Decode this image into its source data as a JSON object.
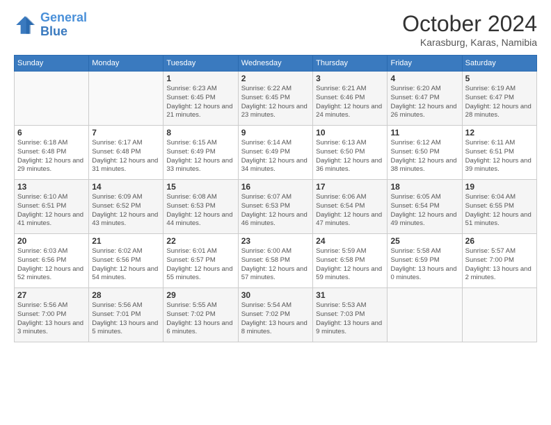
{
  "header": {
    "logo_line1": "General",
    "logo_line2": "Blue",
    "month_title": "October 2024",
    "location": "Karasburg, Karas, Namibia"
  },
  "weekdays": [
    "Sunday",
    "Monday",
    "Tuesday",
    "Wednesday",
    "Thursday",
    "Friday",
    "Saturday"
  ],
  "weeks": [
    [
      {
        "day": "",
        "info": ""
      },
      {
        "day": "",
        "info": ""
      },
      {
        "day": "1",
        "info": "Sunrise: 6:23 AM\nSunset: 6:45 PM\nDaylight: 12 hours and 21 minutes."
      },
      {
        "day": "2",
        "info": "Sunrise: 6:22 AM\nSunset: 6:45 PM\nDaylight: 12 hours and 23 minutes."
      },
      {
        "day": "3",
        "info": "Sunrise: 6:21 AM\nSunset: 6:46 PM\nDaylight: 12 hours and 24 minutes."
      },
      {
        "day": "4",
        "info": "Sunrise: 6:20 AM\nSunset: 6:47 PM\nDaylight: 12 hours and 26 minutes."
      },
      {
        "day": "5",
        "info": "Sunrise: 6:19 AM\nSunset: 6:47 PM\nDaylight: 12 hours and 28 minutes."
      }
    ],
    [
      {
        "day": "6",
        "info": "Sunrise: 6:18 AM\nSunset: 6:48 PM\nDaylight: 12 hours and 29 minutes."
      },
      {
        "day": "7",
        "info": "Sunrise: 6:17 AM\nSunset: 6:48 PM\nDaylight: 12 hours and 31 minutes."
      },
      {
        "day": "8",
        "info": "Sunrise: 6:15 AM\nSunset: 6:49 PM\nDaylight: 12 hours and 33 minutes."
      },
      {
        "day": "9",
        "info": "Sunrise: 6:14 AM\nSunset: 6:49 PM\nDaylight: 12 hours and 34 minutes."
      },
      {
        "day": "10",
        "info": "Sunrise: 6:13 AM\nSunset: 6:50 PM\nDaylight: 12 hours and 36 minutes."
      },
      {
        "day": "11",
        "info": "Sunrise: 6:12 AM\nSunset: 6:50 PM\nDaylight: 12 hours and 38 minutes."
      },
      {
        "day": "12",
        "info": "Sunrise: 6:11 AM\nSunset: 6:51 PM\nDaylight: 12 hours and 39 minutes."
      }
    ],
    [
      {
        "day": "13",
        "info": "Sunrise: 6:10 AM\nSunset: 6:51 PM\nDaylight: 12 hours and 41 minutes."
      },
      {
        "day": "14",
        "info": "Sunrise: 6:09 AM\nSunset: 6:52 PM\nDaylight: 12 hours and 43 minutes."
      },
      {
        "day": "15",
        "info": "Sunrise: 6:08 AM\nSunset: 6:53 PM\nDaylight: 12 hours and 44 minutes."
      },
      {
        "day": "16",
        "info": "Sunrise: 6:07 AM\nSunset: 6:53 PM\nDaylight: 12 hours and 46 minutes."
      },
      {
        "day": "17",
        "info": "Sunrise: 6:06 AM\nSunset: 6:54 PM\nDaylight: 12 hours and 47 minutes."
      },
      {
        "day": "18",
        "info": "Sunrise: 6:05 AM\nSunset: 6:54 PM\nDaylight: 12 hours and 49 minutes."
      },
      {
        "day": "19",
        "info": "Sunrise: 6:04 AM\nSunset: 6:55 PM\nDaylight: 12 hours and 51 minutes."
      }
    ],
    [
      {
        "day": "20",
        "info": "Sunrise: 6:03 AM\nSunset: 6:56 PM\nDaylight: 12 hours and 52 minutes."
      },
      {
        "day": "21",
        "info": "Sunrise: 6:02 AM\nSunset: 6:56 PM\nDaylight: 12 hours and 54 minutes."
      },
      {
        "day": "22",
        "info": "Sunrise: 6:01 AM\nSunset: 6:57 PM\nDaylight: 12 hours and 55 minutes."
      },
      {
        "day": "23",
        "info": "Sunrise: 6:00 AM\nSunset: 6:58 PM\nDaylight: 12 hours and 57 minutes."
      },
      {
        "day": "24",
        "info": "Sunrise: 5:59 AM\nSunset: 6:58 PM\nDaylight: 12 hours and 59 minutes."
      },
      {
        "day": "25",
        "info": "Sunrise: 5:58 AM\nSunset: 6:59 PM\nDaylight: 13 hours and 0 minutes."
      },
      {
        "day": "26",
        "info": "Sunrise: 5:57 AM\nSunset: 7:00 PM\nDaylight: 13 hours and 2 minutes."
      }
    ],
    [
      {
        "day": "27",
        "info": "Sunrise: 5:56 AM\nSunset: 7:00 PM\nDaylight: 13 hours and 3 minutes."
      },
      {
        "day": "28",
        "info": "Sunrise: 5:56 AM\nSunset: 7:01 PM\nDaylight: 13 hours and 5 minutes."
      },
      {
        "day": "29",
        "info": "Sunrise: 5:55 AM\nSunset: 7:02 PM\nDaylight: 13 hours and 6 minutes."
      },
      {
        "day": "30",
        "info": "Sunrise: 5:54 AM\nSunset: 7:02 PM\nDaylight: 13 hours and 8 minutes."
      },
      {
        "day": "31",
        "info": "Sunrise: 5:53 AM\nSunset: 7:03 PM\nDaylight: 13 hours and 9 minutes."
      },
      {
        "day": "",
        "info": ""
      },
      {
        "day": "",
        "info": ""
      }
    ]
  ]
}
